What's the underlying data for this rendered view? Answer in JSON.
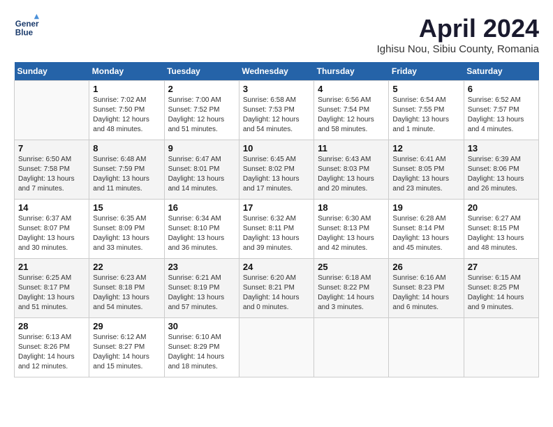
{
  "header": {
    "logo_line1": "General",
    "logo_line2": "Blue",
    "title": "April 2024",
    "subtitle": "Ighisu Nou, Sibiu County, Romania"
  },
  "calendar": {
    "days_of_week": [
      "Sunday",
      "Monday",
      "Tuesday",
      "Wednesday",
      "Thursday",
      "Friday",
      "Saturday"
    ],
    "weeks": [
      [
        {
          "day": "",
          "sunrise": "",
          "sunset": "",
          "daylight": ""
        },
        {
          "day": "1",
          "sunrise": "Sunrise: 7:02 AM",
          "sunset": "Sunset: 7:50 PM",
          "daylight": "Daylight: 12 hours and 48 minutes."
        },
        {
          "day": "2",
          "sunrise": "Sunrise: 7:00 AM",
          "sunset": "Sunset: 7:52 PM",
          "daylight": "Daylight: 12 hours and 51 minutes."
        },
        {
          "day": "3",
          "sunrise": "Sunrise: 6:58 AM",
          "sunset": "Sunset: 7:53 PM",
          "daylight": "Daylight: 12 hours and 54 minutes."
        },
        {
          "day": "4",
          "sunrise": "Sunrise: 6:56 AM",
          "sunset": "Sunset: 7:54 PM",
          "daylight": "Daylight: 12 hours and 58 minutes."
        },
        {
          "day": "5",
          "sunrise": "Sunrise: 6:54 AM",
          "sunset": "Sunset: 7:55 PM",
          "daylight": "Daylight: 13 hours and 1 minute."
        },
        {
          "day": "6",
          "sunrise": "Sunrise: 6:52 AM",
          "sunset": "Sunset: 7:57 PM",
          "daylight": "Daylight: 13 hours and 4 minutes."
        }
      ],
      [
        {
          "day": "7",
          "sunrise": "Sunrise: 6:50 AM",
          "sunset": "Sunset: 7:58 PM",
          "daylight": "Daylight: 13 hours and 7 minutes."
        },
        {
          "day": "8",
          "sunrise": "Sunrise: 6:48 AM",
          "sunset": "Sunset: 7:59 PM",
          "daylight": "Daylight: 13 hours and 11 minutes."
        },
        {
          "day": "9",
          "sunrise": "Sunrise: 6:47 AM",
          "sunset": "Sunset: 8:01 PM",
          "daylight": "Daylight: 13 hours and 14 minutes."
        },
        {
          "day": "10",
          "sunrise": "Sunrise: 6:45 AM",
          "sunset": "Sunset: 8:02 PM",
          "daylight": "Daylight: 13 hours and 17 minutes."
        },
        {
          "day": "11",
          "sunrise": "Sunrise: 6:43 AM",
          "sunset": "Sunset: 8:03 PM",
          "daylight": "Daylight: 13 hours and 20 minutes."
        },
        {
          "day": "12",
          "sunrise": "Sunrise: 6:41 AM",
          "sunset": "Sunset: 8:05 PM",
          "daylight": "Daylight: 13 hours and 23 minutes."
        },
        {
          "day": "13",
          "sunrise": "Sunrise: 6:39 AM",
          "sunset": "Sunset: 8:06 PM",
          "daylight": "Daylight: 13 hours and 26 minutes."
        }
      ],
      [
        {
          "day": "14",
          "sunrise": "Sunrise: 6:37 AM",
          "sunset": "Sunset: 8:07 PM",
          "daylight": "Daylight: 13 hours and 30 minutes."
        },
        {
          "day": "15",
          "sunrise": "Sunrise: 6:35 AM",
          "sunset": "Sunset: 8:09 PM",
          "daylight": "Daylight: 13 hours and 33 minutes."
        },
        {
          "day": "16",
          "sunrise": "Sunrise: 6:34 AM",
          "sunset": "Sunset: 8:10 PM",
          "daylight": "Daylight: 13 hours and 36 minutes."
        },
        {
          "day": "17",
          "sunrise": "Sunrise: 6:32 AM",
          "sunset": "Sunset: 8:11 PM",
          "daylight": "Daylight: 13 hours and 39 minutes."
        },
        {
          "day": "18",
          "sunrise": "Sunrise: 6:30 AM",
          "sunset": "Sunset: 8:13 PM",
          "daylight": "Daylight: 13 hours and 42 minutes."
        },
        {
          "day": "19",
          "sunrise": "Sunrise: 6:28 AM",
          "sunset": "Sunset: 8:14 PM",
          "daylight": "Daylight: 13 hours and 45 minutes."
        },
        {
          "day": "20",
          "sunrise": "Sunrise: 6:27 AM",
          "sunset": "Sunset: 8:15 PM",
          "daylight": "Daylight: 13 hours and 48 minutes."
        }
      ],
      [
        {
          "day": "21",
          "sunrise": "Sunrise: 6:25 AM",
          "sunset": "Sunset: 8:17 PM",
          "daylight": "Daylight: 13 hours and 51 minutes."
        },
        {
          "day": "22",
          "sunrise": "Sunrise: 6:23 AM",
          "sunset": "Sunset: 8:18 PM",
          "daylight": "Daylight: 13 hours and 54 minutes."
        },
        {
          "day": "23",
          "sunrise": "Sunrise: 6:21 AM",
          "sunset": "Sunset: 8:19 PM",
          "daylight": "Daylight: 13 hours and 57 minutes."
        },
        {
          "day": "24",
          "sunrise": "Sunrise: 6:20 AM",
          "sunset": "Sunset: 8:21 PM",
          "daylight": "Daylight: 14 hours and 0 minutes."
        },
        {
          "day": "25",
          "sunrise": "Sunrise: 6:18 AM",
          "sunset": "Sunset: 8:22 PM",
          "daylight": "Daylight: 14 hours and 3 minutes."
        },
        {
          "day": "26",
          "sunrise": "Sunrise: 6:16 AM",
          "sunset": "Sunset: 8:23 PM",
          "daylight": "Daylight: 14 hours and 6 minutes."
        },
        {
          "day": "27",
          "sunrise": "Sunrise: 6:15 AM",
          "sunset": "Sunset: 8:25 PM",
          "daylight": "Daylight: 14 hours and 9 minutes."
        }
      ],
      [
        {
          "day": "28",
          "sunrise": "Sunrise: 6:13 AM",
          "sunset": "Sunset: 8:26 PM",
          "daylight": "Daylight: 14 hours and 12 minutes."
        },
        {
          "day": "29",
          "sunrise": "Sunrise: 6:12 AM",
          "sunset": "Sunset: 8:27 PM",
          "daylight": "Daylight: 14 hours and 15 minutes."
        },
        {
          "day": "30",
          "sunrise": "Sunrise: 6:10 AM",
          "sunset": "Sunset: 8:29 PM",
          "daylight": "Daylight: 14 hours and 18 minutes."
        },
        {
          "day": "",
          "sunrise": "",
          "sunset": "",
          "daylight": ""
        },
        {
          "day": "",
          "sunrise": "",
          "sunset": "",
          "daylight": ""
        },
        {
          "day": "",
          "sunrise": "",
          "sunset": "",
          "daylight": ""
        },
        {
          "day": "",
          "sunrise": "",
          "sunset": "",
          "daylight": ""
        }
      ]
    ]
  }
}
